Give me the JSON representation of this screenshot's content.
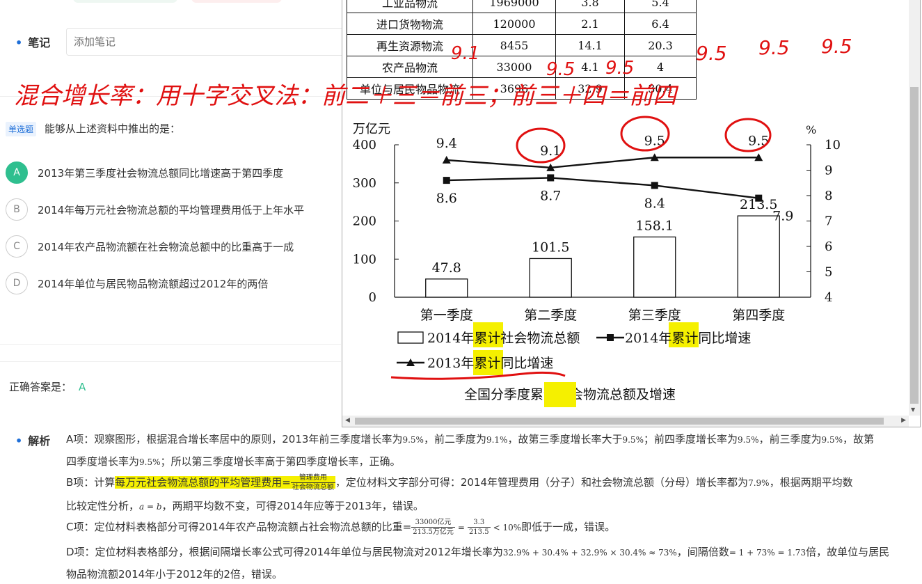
{
  "notes": {
    "label": "笔记",
    "placeholder": "添加笔记"
  },
  "question": {
    "type_tag": "单选题",
    "text": "能够从上述资料中推出的是：",
    "options": [
      {
        "letter": "A",
        "text": "2013年第三季度社会物流总额同比增速高于第四季度",
        "selected": true
      },
      {
        "letter": "B",
        "text": "2014年每万元社会物流总额的平均管理费用低于上年水平",
        "selected": false
      },
      {
        "letter": "C",
        "text": "2014年农产品物流额在社会物流总额中的比重高于一成",
        "selected": false
      },
      {
        "letter": "D",
        "text": "2014年单位与居民物品物流额超过2012年的两倍",
        "selected": false
      }
    ]
  },
  "answer": {
    "label": "正确答案是：",
    "value": "A"
  },
  "analysis": {
    "label": "解析",
    "a1": "A项：观察图形，根据混合增长率居中的原则，2013年前三季度增长率为",
    "a1_m1": "9.5%",
    "a1_t2": "，前二季度为",
    "a1_m2": "9.1%",
    "a1_t3": "，故第三季度增长率大于",
    "a1_m3": "9.5%",
    "a1_t4": "；前四季度增长率为",
    "a1_m4": "9.5%",
    "a1_t5": "，前三季度为",
    "a1_m5": "9.5%",
    "a1_t6": "，故第",
    "a2_t1": "四季度增长率为",
    "a2_m1": "9.5%",
    "a2_t2": "；所以第三季度增长率高于第四季度增长率，正确。",
    "b1_t1": "B项：计算",
    "b1_hl": "每万元社会物流总额的平均管理费用=",
    "b1_frac_num": "管理费用",
    "b1_frac_den": "社会物流总额",
    "b1_t2": "，定位材料文字部分可得：2014年管理费用（分子）和社会物流总额（分母）增长率都为",
    "b1_m1": "7.9%",
    "b1_t3": "，根据两期平均数",
    "b2_t1": "比较定性分析，",
    "b2_m1": "a = b",
    "b2_t2": "，两期平均数不变，可得2014年应等于2013年，错误。",
    "c1_t1": "C项：定位材料表格部分可得2014年农产品物流额占社会物流总额的比重=",
    "c1_f1_num": "33000亿元",
    "c1_f1_den": "213.5万亿元",
    "c1_eq": "=",
    "c1_f2_num": "3.3",
    "c1_f2_den": "213.5",
    "c1_m1": "< 10%",
    "c1_t2": "即低于一成，错误。",
    "d1_t1": "D项：定位材料表格部分，根据间隔增长率公式可得2014年单位与居民物流对2012年增长率为",
    "d1_m1": "32.9% + 30.4% + 32.9% × 30.4% ≈ 73%",
    "d1_t2": "，间隔倍数",
    "d1_m2": "= 1 + 73% = 1.73",
    "d1_t3": "倍，故单位与居民",
    "d2_t1": "物品物流额2014年小于2012年的2倍，错误。"
  },
  "table": {
    "rows": [
      [
        "工业品物流",
        "1969000",
        "3.8",
        "5.4"
      ],
      [
        "进口货物物流",
        "120000",
        "2.1",
        "6.4"
      ],
      [
        "再生资源物流",
        "8455",
        "14.1",
        "20.3"
      ],
      [
        "农产品物流",
        "33000",
        "4.1",
        "4"
      ],
      [
        "单位与居民物品物流",
        "3696",
        "32.9",
        "30.4"
      ]
    ]
  },
  "chart_data": {
    "type": "bar",
    "title": "全国分季度累计社会物流总额及增速",
    "categories": [
      "第一季度",
      "第二季度",
      "第三季度",
      "第四季度"
    ],
    "y_left_label": "万亿元",
    "y_right_label": "%",
    "y_left_ticks": [
      0,
      100,
      200,
      300,
      400
    ],
    "y_right_ticks": [
      4,
      5,
      6,
      7,
      8,
      9,
      10
    ],
    "ylim_left": [
      0,
      400
    ],
    "ylim_right": [
      4,
      10
    ],
    "bars": {
      "name": "2014年累计社会物流总额",
      "values": [
        47.8,
        101.5,
        158.1,
        213.5
      ]
    },
    "series": [
      {
        "name": "2014年累计同比增速",
        "marker": "square",
        "values": [
          8.6,
          8.7,
          8.4,
          7.9
        ]
      },
      {
        "name": "2013年累计同比增速",
        "marker": "triangle",
        "values": [
          9.4,
          9.1,
          9.5,
          9.5
        ]
      }
    ],
    "legend_position": "bottom"
  },
  "annotations": {
    "main": "混合增长率：用十字交叉法：前二＋三＝前三；前三＋四＝前四",
    "n1": "9.1",
    "n2": "9.5",
    "n3": "9.5",
    "n4": "9.5",
    "n5": "9.5",
    "n6": "9.5",
    "annotation_color": "#e01010",
    "highlight_color": "#f5f000"
  }
}
